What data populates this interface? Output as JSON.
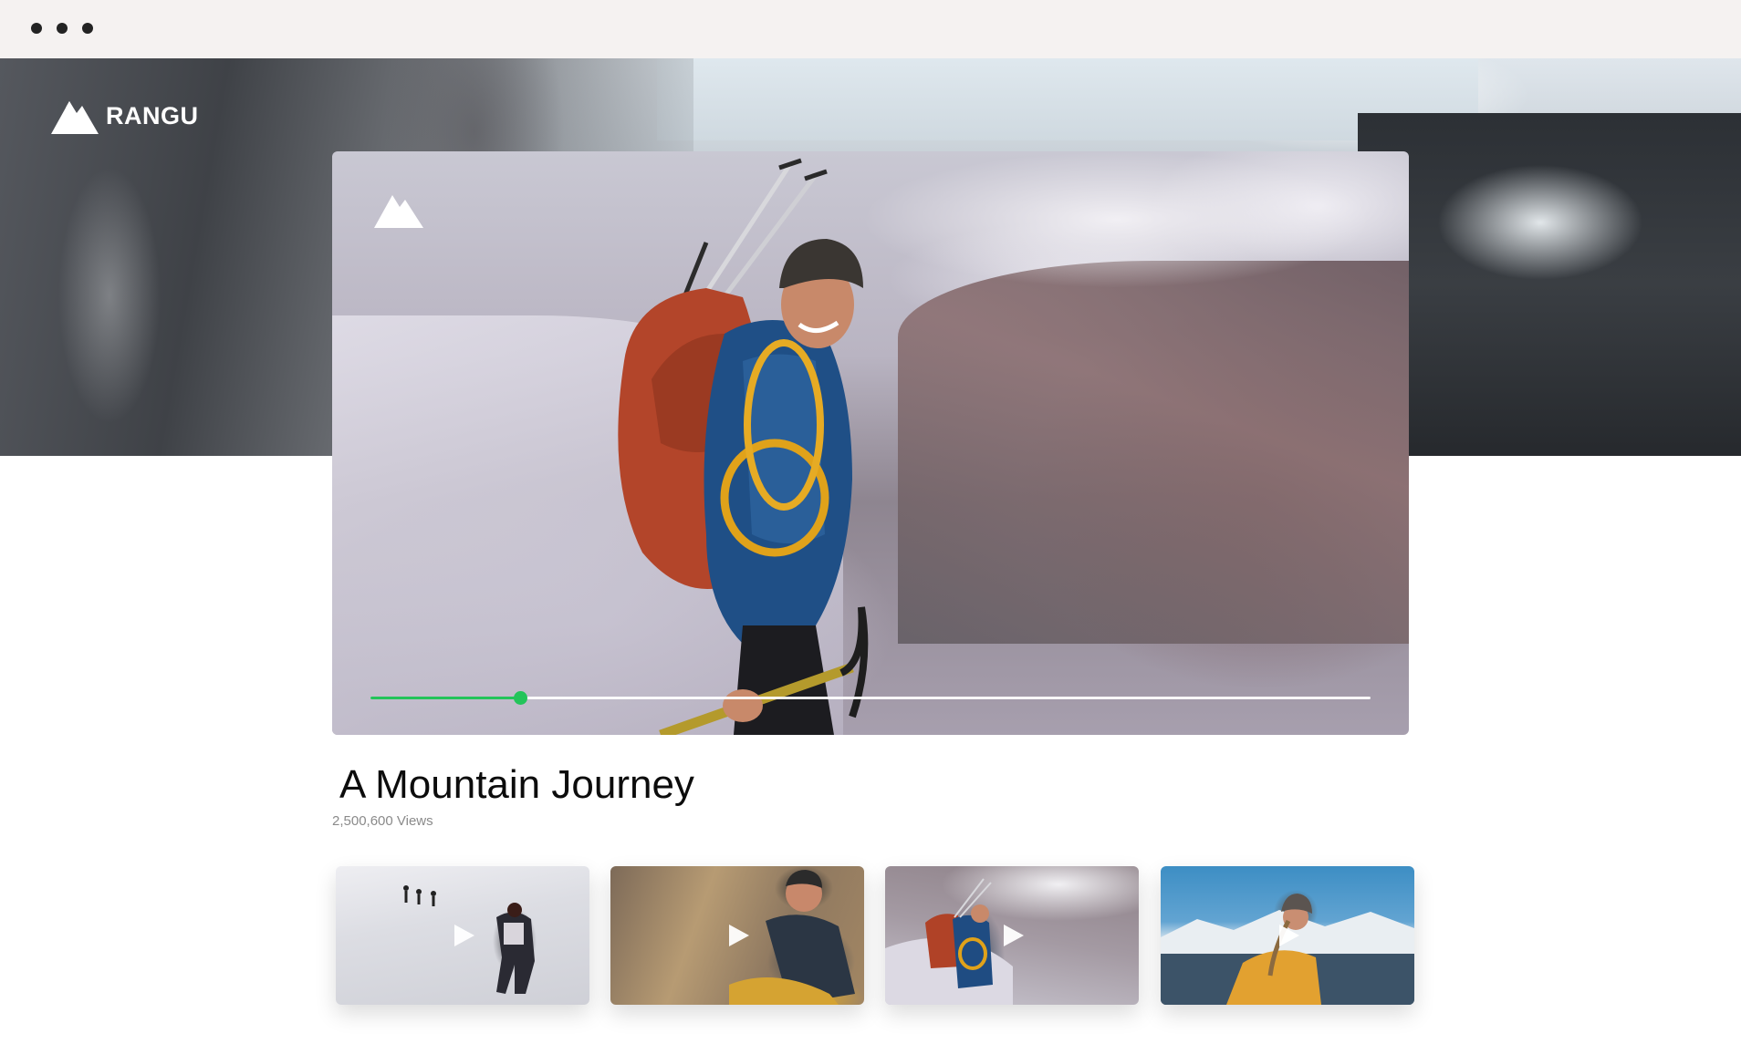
{
  "window": {
    "controls": [
      "dot",
      "dot",
      "dot"
    ]
  },
  "brand": {
    "name": "RANGU",
    "icon": "mountain-logo-icon"
  },
  "player": {
    "watermark_icon": "mountain-logo-icon",
    "progress": 0.15,
    "progress_color": "#23c45a"
  },
  "video": {
    "title": "A Mountain Journey",
    "views": "2,500,600 Views"
  },
  "related": [
    {
      "scene": "snow-trekkers",
      "icon": "play-icon"
    },
    {
      "scene": "rock-climber",
      "icon": "play-icon"
    },
    {
      "scene": "glacier-hiker",
      "icon": "play-icon"
    },
    {
      "scene": "mountain-view-hiker",
      "icon": "play-icon"
    }
  ]
}
